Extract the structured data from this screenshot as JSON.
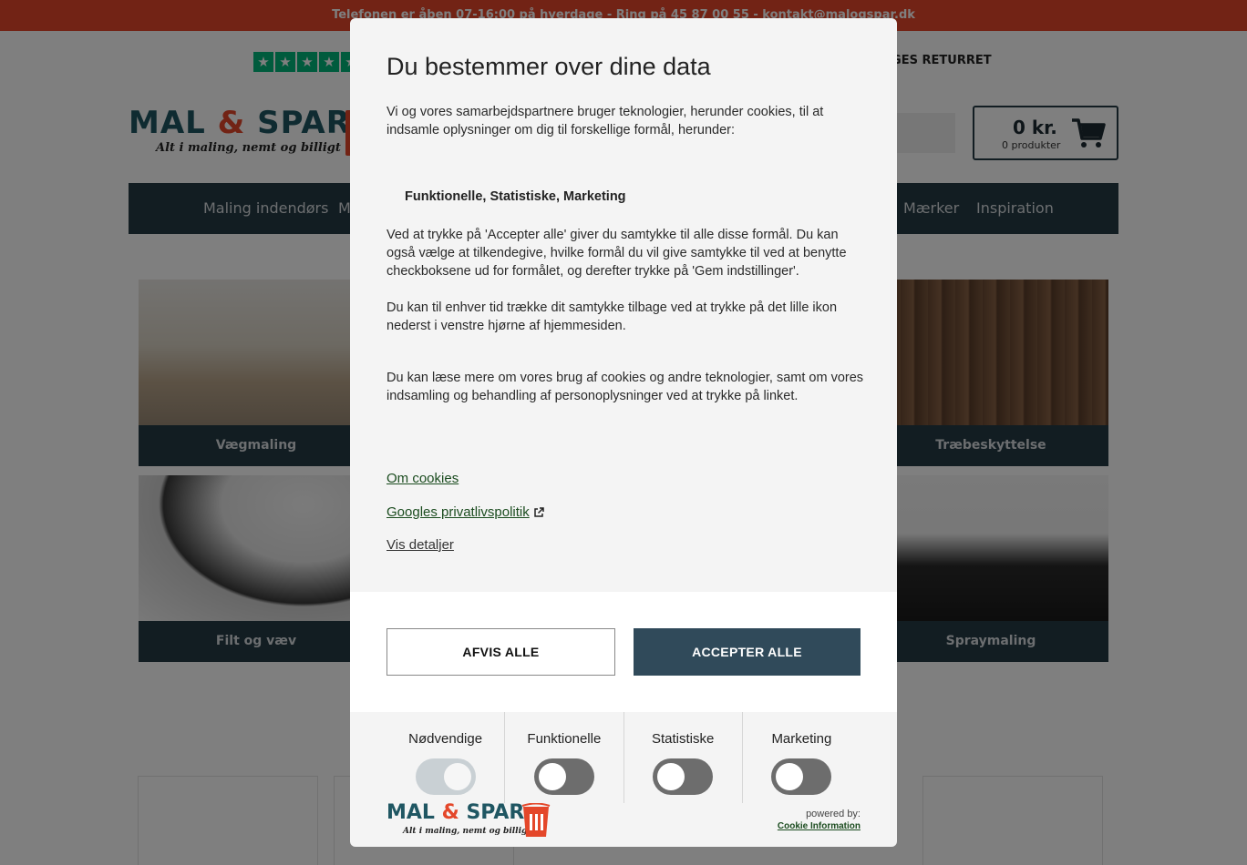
{
  "background": {
    "topbar_text": "Telefonen er åben 07-16:00 på hverdage - Ring på 45 87 00 55 - kontakt@malogspar.dk",
    "usp_text": "AGES RETURRET",
    "logo": {
      "brand_part1": "MAL ",
      "amp": "&",
      "brand_part2": " SPAR",
      "tagline": "Alt i maling, nemt og billigt"
    },
    "cart": {
      "total": "0 kr.",
      "count": "0 produkter"
    },
    "nav": [
      {
        "label": "Maling indendørs"
      },
      {
        "label": "M"
      },
      {
        "label": "Mærker"
      },
      {
        "label": "Inspiration"
      }
    ],
    "tiles": [
      {
        "label": "Vægmaling"
      },
      {
        "label": "Træbeskyttelse"
      },
      {
        "label": "Filt og væv"
      },
      {
        "label": "Spraymaling"
      }
    ]
  },
  "modal": {
    "title": "Du bestemmer over dine data",
    "intro": "Vi og vores samarbejdspartnere bruger teknologier, herunder cookies, til at indsamle oplysninger om dig til forskellige formål, herunder:",
    "purposes": "Funktionelle, Statistiske, Marketing",
    "consent_text_1": "Ved at trykke på 'Accepter alle' giver du samtykke til alle disse formål. Du kan også vælge at tilkendegive, hvilke formål du vil give samtykke til ved at benytte checkboksene ud for formålet, og derefter trykke på 'Gem indstillinger'.",
    "consent_text_2": "Du kan til enhver tid trække dit samtykke tilbage ved at trykke på det lille ikon nederst i venstre hjørne af hjemmesiden.",
    "more_info": "Du kan læse mere om vores brug af cookies og andre teknologier, samt om vores indsamling og behandling af personoplysninger ved at trykke på linket.",
    "links": {
      "about_cookies": "Om cookies",
      "google_privacy": "Googles privatlivspolitik",
      "show_details": "Vis detaljer"
    },
    "buttons": {
      "reject": "AFVIS ALLE",
      "accept": "ACCEPTER ALLE"
    },
    "toggles": [
      {
        "label": "Nødvendige",
        "on": true
      },
      {
        "label": "Funktionelle",
        "on": false
      },
      {
        "label": "Statistiske",
        "on": false
      },
      {
        "label": "Marketing",
        "on": false
      }
    ],
    "footer": {
      "logo_part1": "MAL ",
      "logo_amp": "&",
      "logo_part2": " SPAR",
      "logo_tagline": "Alt i maling, nemt og billigt",
      "powered_label": "powered by:",
      "powered_link": "Cookie Information"
    }
  },
  "colors": {
    "brand_red": "#e4472a",
    "nav_dark": "#243a44",
    "accept_button": "#304a5a",
    "link_green": "#1b4c1f"
  }
}
